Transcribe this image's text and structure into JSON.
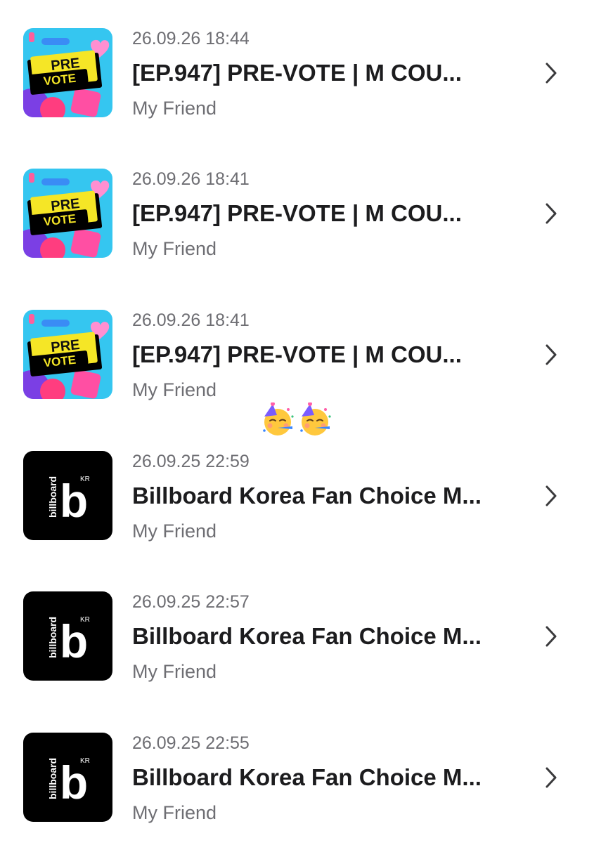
{
  "messages": [
    {
      "time": "26.09.26 18:44",
      "title": "[EP.947] PRE-VOTE | M COU...",
      "sender": "My Friend",
      "thumbnail": {
        "icon": "pre-vote-thumbnail",
        "line1": "PRE",
        "line2": "VOTE"
      }
    },
    {
      "time": "26.09.26 18:41",
      "title": "[EP.947] PRE-VOTE | M COU...",
      "sender": "My Friend",
      "thumbnail": {
        "icon": "pre-vote-thumbnail",
        "line1": "PRE",
        "line2": "VOTE"
      }
    },
    {
      "time": "26.09.26 18:41",
      "title": "[EP.947] PRE-VOTE | M COU...",
      "sender": "My Friend",
      "thumbnail": {
        "icon": "pre-vote-thumbnail",
        "line1": "PRE",
        "line2": "VOTE"
      }
    },
    {
      "time": "26.09.25 22:59",
      "title": "Billboard Korea Fan Choice M...",
      "sender": "My Friend",
      "thumbnail": {
        "icon": "billboard-korea-logo",
        "word": "billboard",
        "letter": "b",
        "region": "KR"
      }
    },
    {
      "time": "26.09.25 22:57",
      "title": "Billboard Korea Fan Choice M...",
      "sender": "My Friend",
      "thumbnail": {
        "icon": "billboard-korea-logo",
        "word": "billboard",
        "letter": "b",
        "region": "KR"
      }
    },
    {
      "time": "26.09.25 22:55",
      "title": "Billboard Korea Fan Choice M...",
      "sender": "My Friend",
      "thumbnail": {
        "icon": "billboard-korea-logo",
        "word": "billboard",
        "letter": "b",
        "region": "KR"
      }
    }
  ],
  "emoji_overlay": [
    "partying-face-emoji",
    "partying-face-emoji"
  ],
  "colors": {
    "time_text": "#6e6e73",
    "title_text": "#1c1c1e",
    "sender_text": "#6e6e73",
    "chevron": "#3a3a3c",
    "prevote_bg": "#35c6f0",
    "prevote_banner": "#f5e626",
    "billboard_bg": "#000000"
  },
  "chevron_icon": "chevron-right-icon"
}
